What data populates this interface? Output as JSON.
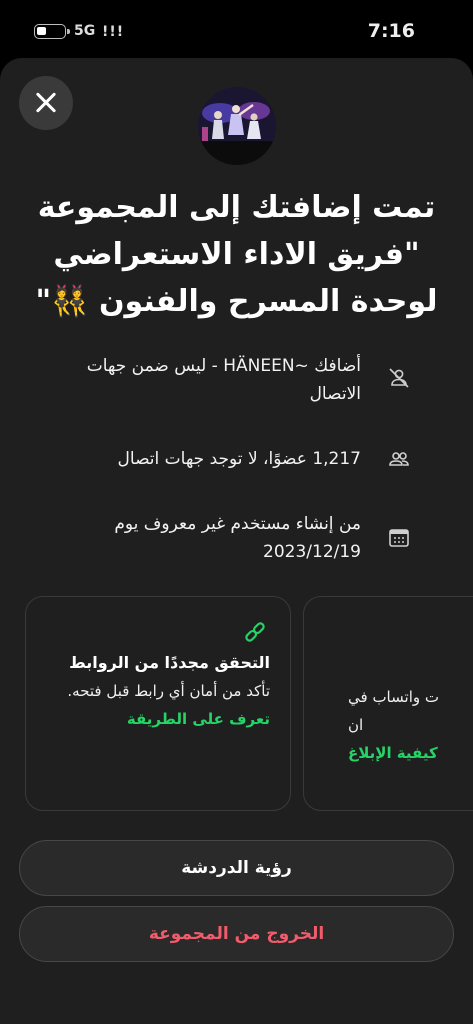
{
  "status_bar": {
    "network": "5G",
    "signal": "!!!",
    "time": "7:16"
  },
  "group": {
    "title_line1": "تمت إضافتك إلى المجموعة",
    "title_line2": "\"فريق الاداء الاستعراضي",
    "title_line3": "لوحدة المسرح والفنون 👯\""
  },
  "info": {
    "added_by": "أضافك ~HÄNEEN - ليس ضمن جهات الاتصال",
    "members": "1,217 عضوًا، لا توجد جهات اتصال",
    "created": "من إنشاء مستخدم غير معروف يوم 2023/12/19"
  },
  "cards": {
    "links_title": "التحقق مجددًا من الروابط",
    "links_body": "تأكد من أمان أي رابط قبل فتحه.",
    "links_cta": "تعرف على الطريقة",
    "report_line1": "ت واتساب في",
    "report_line2": "ان",
    "report_cta": "كيفية الإبلاغ"
  },
  "buttons": {
    "view_chat": "رؤية الدردشة",
    "exit_group": "الخروج من المجموعة"
  },
  "colors": {
    "accent_green": "#25d366",
    "danger_red": "#f15c6d"
  }
}
